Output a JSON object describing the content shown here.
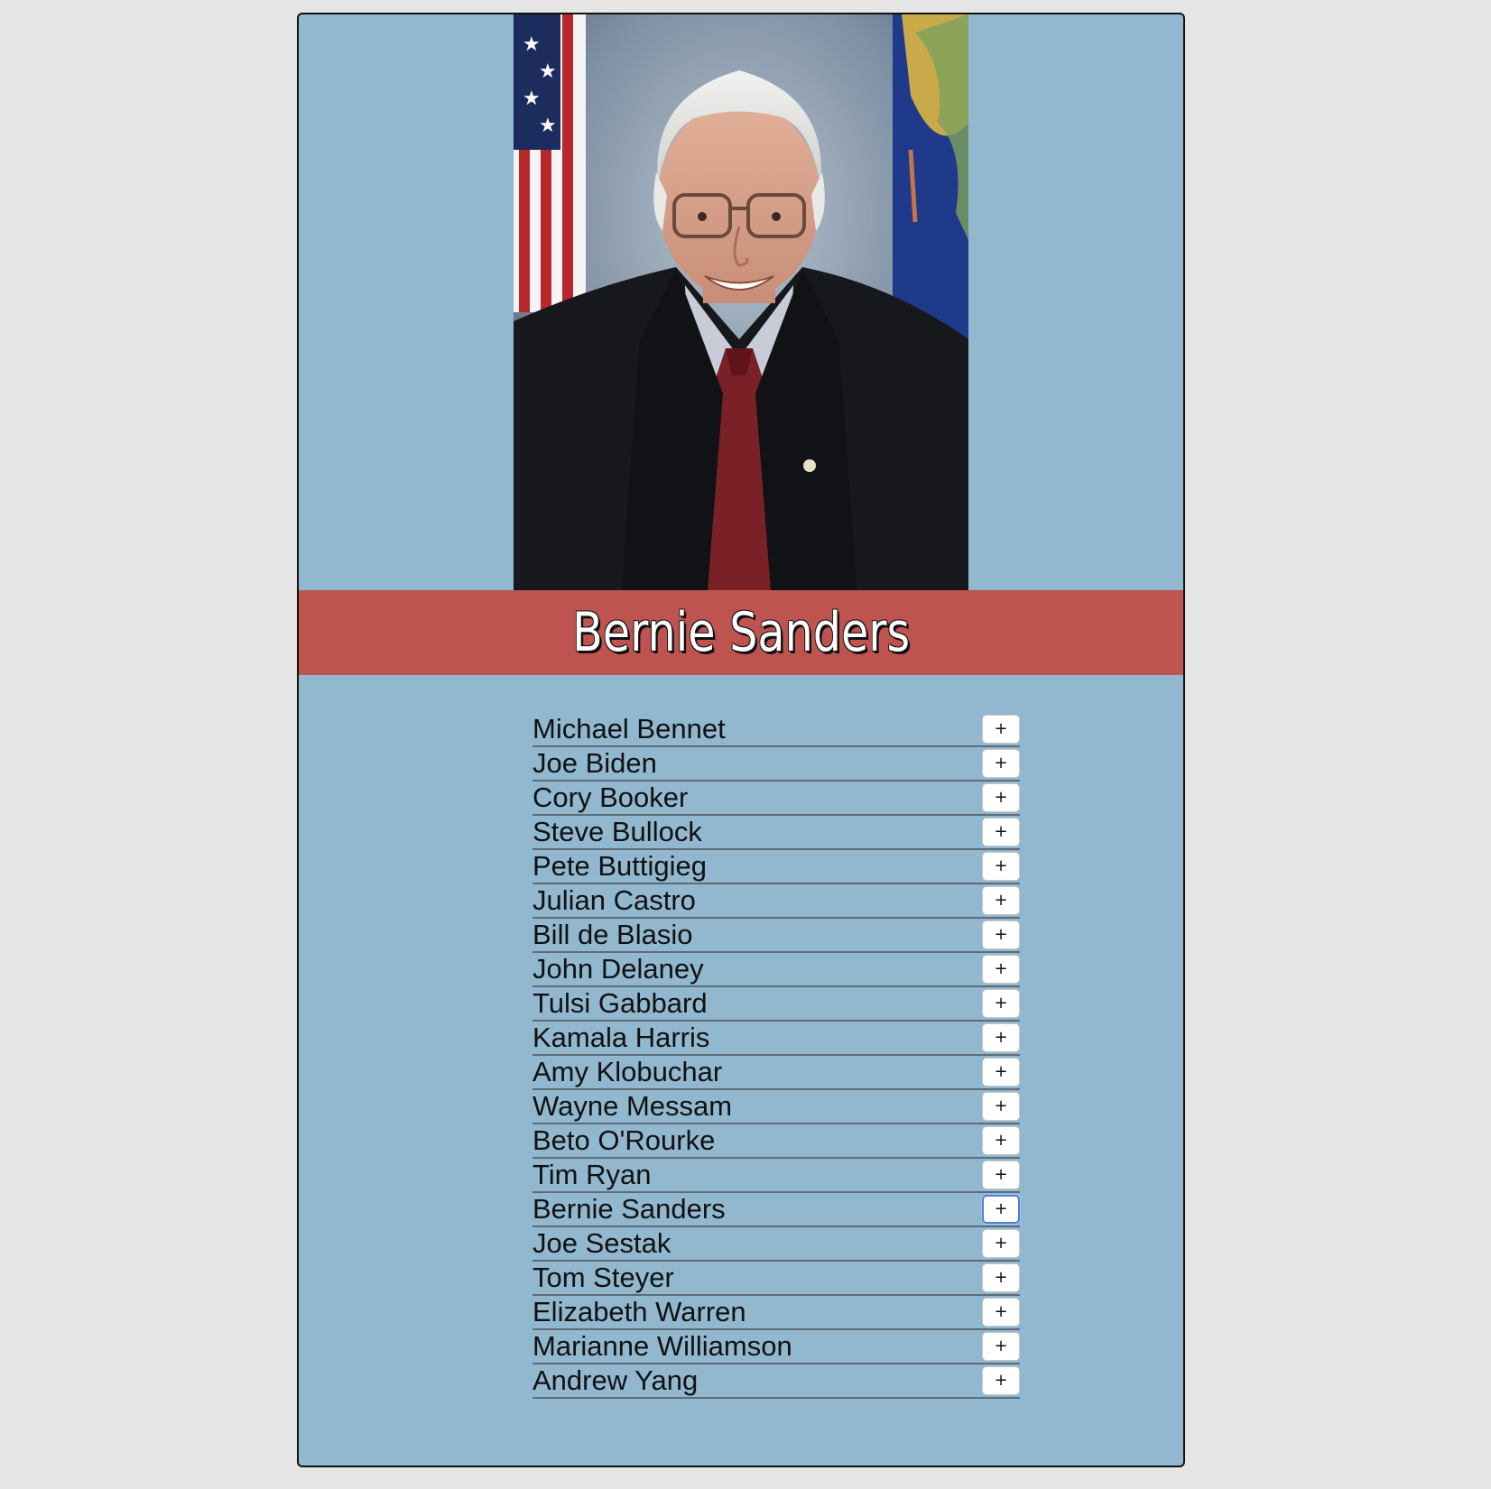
{
  "selected_candidate": {
    "name": "Bernie Sanders",
    "photo_label": "portrait"
  },
  "add_button_label": "+",
  "focused_row_index": 14,
  "colors": {
    "page_background": "#e5e5e5",
    "card_background": "#91b8cf",
    "banner_background": "#bd5450",
    "button_focus": "#4a7fd6"
  },
  "candidates": [
    {
      "name": "Michael Bennet"
    },
    {
      "name": "Joe Biden"
    },
    {
      "name": "Cory Booker"
    },
    {
      "name": "Steve Bullock"
    },
    {
      "name": "Pete Buttigieg"
    },
    {
      "name": "Julian Castro"
    },
    {
      "name": "Bill de Blasio"
    },
    {
      "name": "John Delaney"
    },
    {
      "name": "Tulsi Gabbard"
    },
    {
      "name": "Kamala Harris"
    },
    {
      "name": "Amy Klobuchar"
    },
    {
      "name": "Wayne Messam"
    },
    {
      "name": "Beto O'Rourke"
    },
    {
      "name": "Tim Ryan"
    },
    {
      "name": "Bernie Sanders"
    },
    {
      "name": "Joe Sestak"
    },
    {
      "name": "Tom Steyer"
    },
    {
      "name": "Elizabeth Warren"
    },
    {
      "name": "Marianne Williamson"
    },
    {
      "name": "Andrew Yang"
    }
  ]
}
